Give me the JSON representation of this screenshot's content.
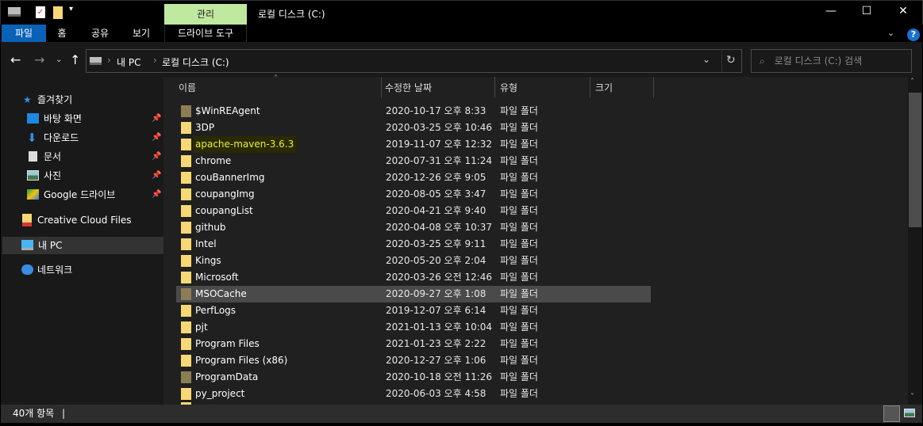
{
  "window": {
    "title": "로컬 디스크 (C:)",
    "contextual_tab": "관리"
  },
  "ribbon": {
    "tabs": [
      "파일",
      "홈",
      "공유",
      "보기",
      "드라이브 도구"
    ]
  },
  "address": {
    "crumbs": [
      "내 PC",
      "로컬 디스크 (C:)"
    ],
    "search_placeholder": "로컬 디스크 (C:) 검색"
  },
  "sidebar": {
    "items": [
      {
        "label": "즐겨찾기",
        "icon": "star-icon"
      },
      {
        "label": "바탕 화면",
        "icon": "desktop-icon",
        "pinned": true
      },
      {
        "label": "다운로드",
        "icon": "download-icon",
        "pinned": true
      },
      {
        "label": "문서",
        "icon": "document-icon",
        "pinned": true
      },
      {
        "label": "사진",
        "icon": "pictures-icon",
        "pinned": true
      },
      {
        "label": "Google 드라이브",
        "icon": "google-drive-icon",
        "pinned": true
      },
      {
        "label": "Creative Cloud Files",
        "icon": "creative-cloud-icon"
      },
      {
        "label": "내 PC",
        "icon": "pc-icon",
        "selected": true
      },
      {
        "label": "네트워크",
        "icon": "network-icon"
      }
    ]
  },
  "columns": [
    "이름",
    "수정한 날짜",
    "유형",
    "크기"
  ],
  "files": [
    {
      "name": "$WinREAgent",
      "date": "2020-10-17 오후 8:33",
      "type": "파일 폴더",
      "hidden": true
    },
    {
      "name": "3DP",
      "date": "2020-03-25 오후 10:46",
      "type": "파일 폴더"
    },
    {
      "name": "apache-maven-3.6.3",
      "date": "2019-11-07 오후 12:32",
      "type": "파일 폴더",
      "highlight": true
    },
    {
      "name": "chrome",
      "date": "2020-07-31 오후 11:24",
      "type": "파일 폴더"
    },
    {
      "name": "couBannerImg",
      "date": "2020-12-26 오후 9:05",
      "type": "파일 폴더"
    },
    {
      "name": "coupangImg",
      "date": "2020-08-05 오후 3:47",
      "type": "파일 폴더"
    },
    {
      "name": "coupangList",
      "date": "2020-04-21 오후 9:40",
      "type": "파일 폴더"
    },
    {
      "name": "github",
      "date": "2020-04-08 오후 10:37",
      "type": "파일 폴더"
    },
    {
      "name": "Intel",
      "date": "2020-03-25 오후 9:11",
      "type": "파일 폴더"
    },
    {
      "name": "Kings",
      "date": "2020-05-20 오후 2:04",
      "type": "파일 폴더"
    },
    {
      "name": "Microsoft",
      "date": "2020-03-26 오전 12:46",
      "type": "파일 폴더"
    },
    {
      "name": "MSOCache",
      "date": "2020-09-27 오후 1:08",
      "type": "파일 폴더",
      "hidden": true,
      "selected": true
    },
    {
      "name": "PerfLogs",
      "date": "2019-12-07 오후 6:14",
      "type": "파일 폴더"
    },
    {
      "name": "pjt",
      "date": "2021-01-13 오후 10:04",
      "type": "파일 폴더"
    },
    {
      "name": "Program Files",
      "date": "2021-01-23 오후 2:22",
      "type": "파일 폴더"
    },
    {
      "name": "Program Files (x86)",
      "date": "2020-12-27 오후 1:06",
      "type": "파일 폴더"
    },
    {
      "name": "ProgramData",
      "date": "2020-10-18 오전 11:26",
      "type": "파일 폴더",
      "hidden": true
    },
    {
      "name": "py_project",
      "date": "2020-06-03 오후 4:58",
      "type": "파일 폴더"
    }
  ],
  "status": {
    "count": "40개 항목"
  }
}
